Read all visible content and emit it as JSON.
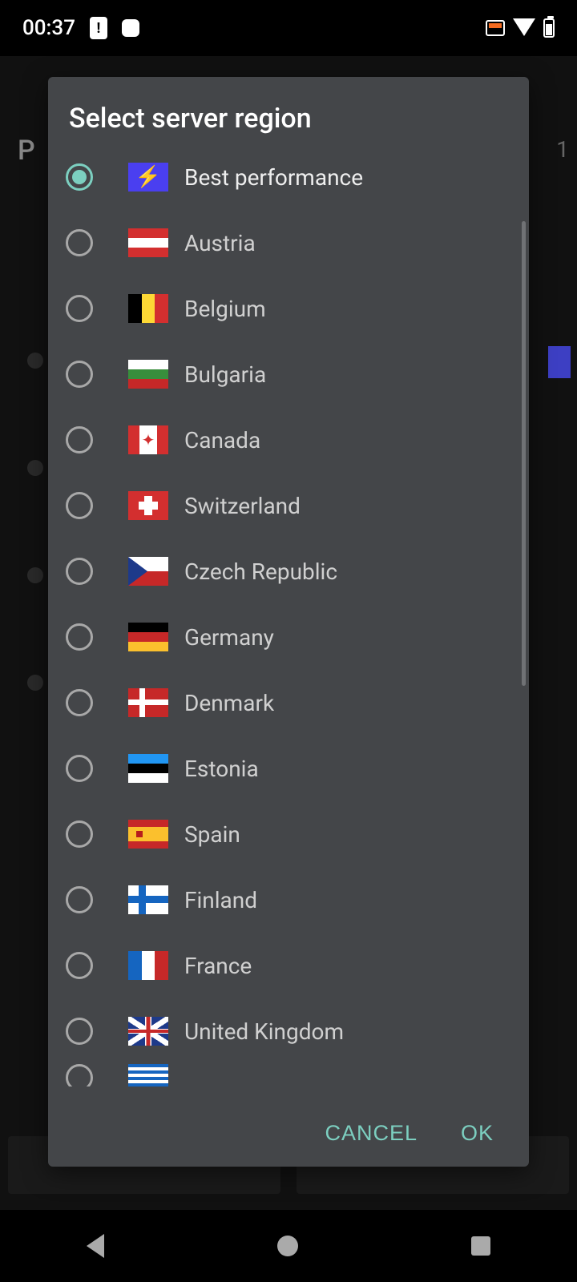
{
  "statusbar": {
    "time": "00:37"
  },
  "background": {
    "peek_left": "P",
    "peek_right": "1"
  },
  "dialog": {
    "title": "Select server region",
    "options": [
      {
        "id": "best",
        "label": "Best performance",
        "selected": true,
        "flag": "f-best"
      },
      {
        "id": "at",
        "label": "Austria",
        "selected": false,
        "flag": "f-at"
      },
      {
        "id": "be",
        "label": "Belgium",
        "selected": false,
        "flag": "f-be"
      },
      {
        "id": "bg",
        "label": "Bulgaria",
        "selected": false,
        "flag": "f-bg"
      },
      {
        "id": "ca",
        "label": "Canada",
        "selected": false,
        "flag": "f-ca"
      },
      {
        "id": "ch",
        "label": "Switzerland",
        "selected": false,
        "flag": "f-ch"
      },
      {
        "id": "cz",
        "label": "Czech Republic",
        "selected": false,
        "flag": "f-cz"
      },
      {
        "id": "de",
        "label": "Germany",
        "selected": false,
        "flag": "f-de"
      },
      {
        "id": "dk",
        "label": "Denmark",
        "selected": false,
        "flag": "f-dk"
      },
      {
        "id": "ee",
        "label": "Estonia",
        "selected": false,
        "flag": "f-ee"
      },
      {
        "id": "es",
        "label": "Spain",
        "selected": false,
        "flag": "f-es"
      },
      {
        "id": "fi",
        "label": "Finland",
        "selected": false,
        "flag": "f-fi"
      },
      {
        "id": "fr",
        "label": "France",
        "selected": false,
        "flag": "f-fr"
      },
      {
        "id": "gb",
        "label": "United Kingdom",
        "selected": false,
        "flag": "f-gb"
      },
      {
        "id": "gr",
        "label": "",
        "selected": false,
        "flag": "f-gr",
        "partial": true
      }
    ],
    "cancel": "CANCEL",
    "ok": "OK"
  }
}
